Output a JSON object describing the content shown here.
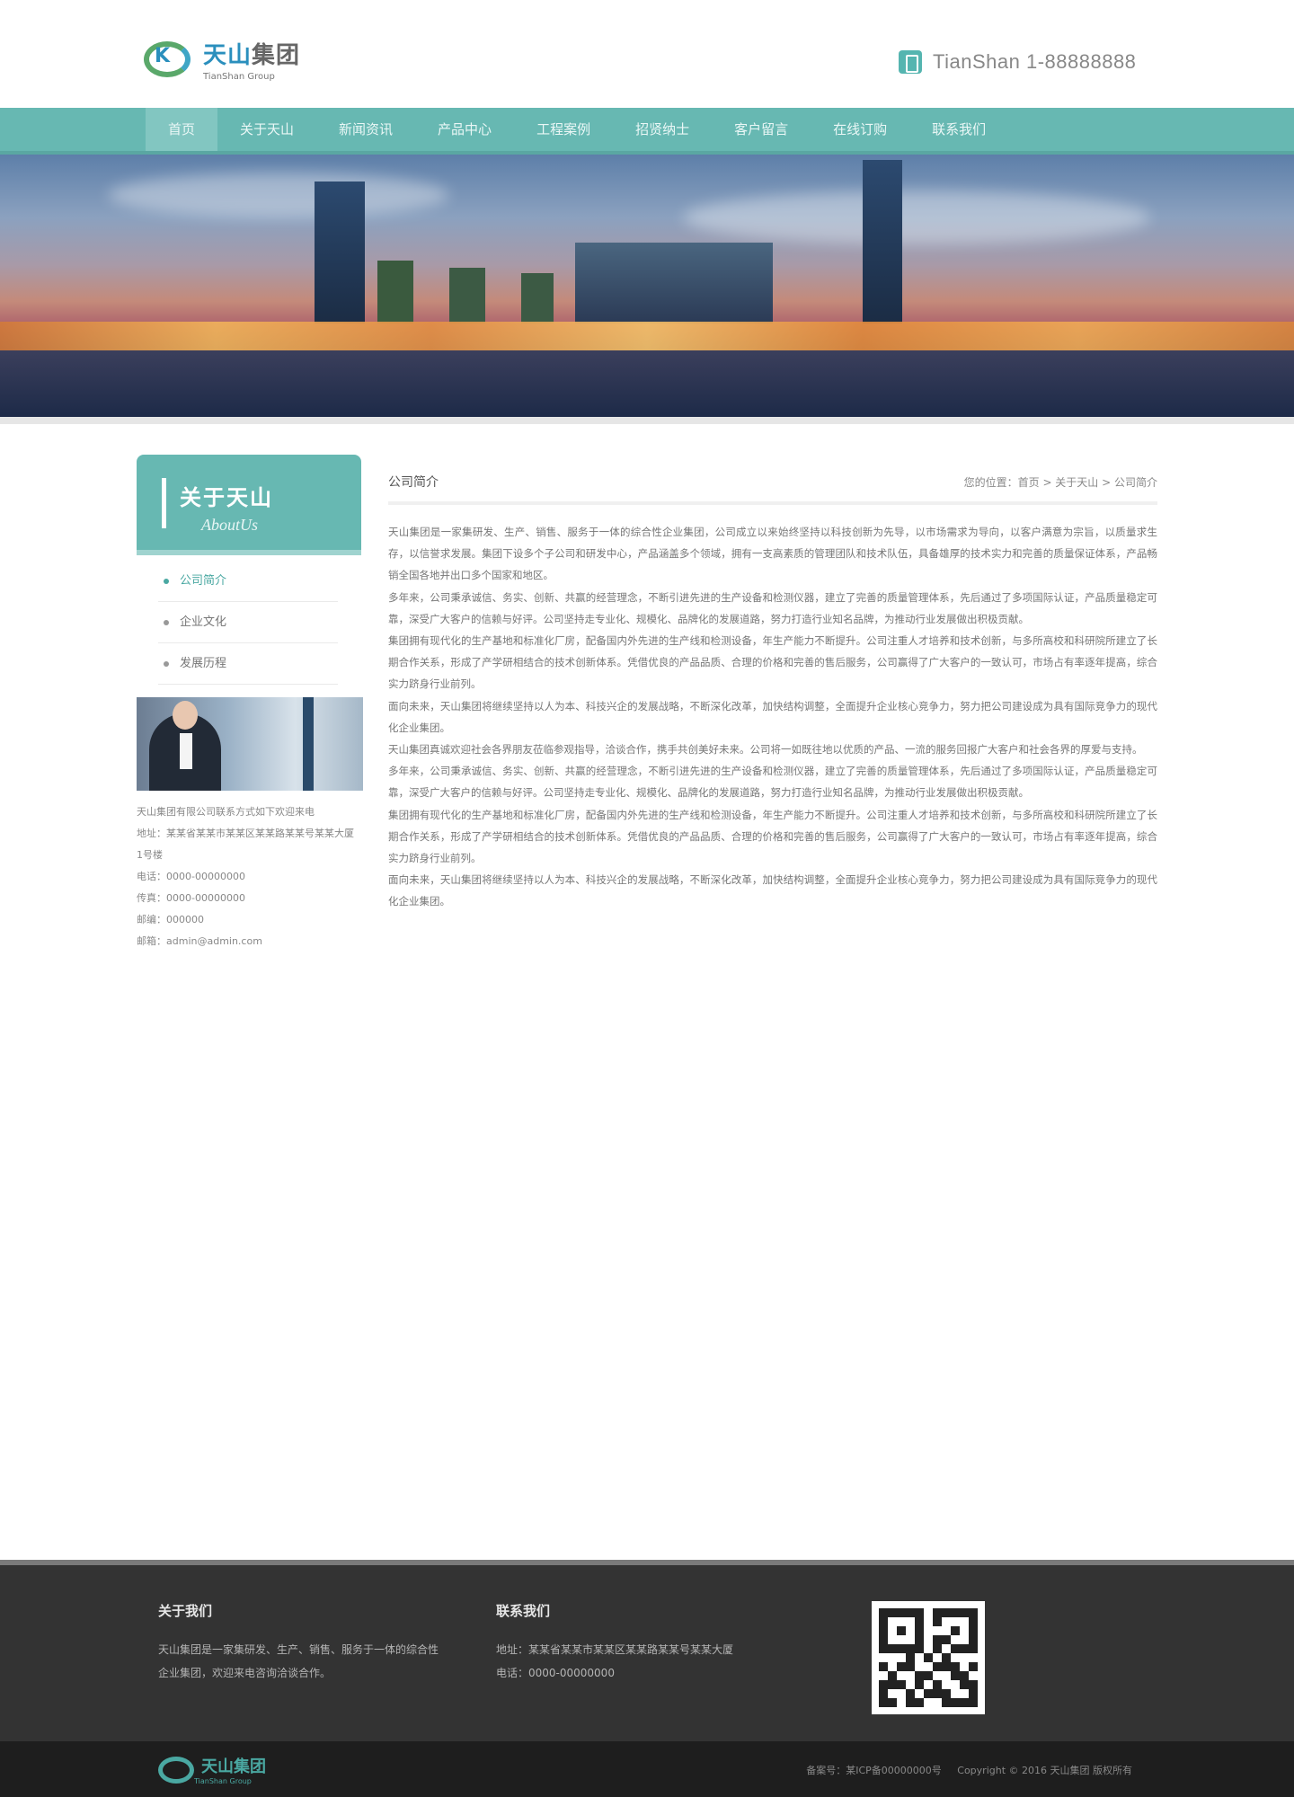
{
  "header": {
    "logo": {
      "cn_blue": "天山",
      "cn_gray": "集团",
      "en": "TianShan Group"
    },
    "hotline": "TianShan 1-88888888"
  },
  "nav": {
    "items": [
      "首页",
      "关于天山",
      "新闻资讯",
      "产品中心",
      "工程案例",
      "招贤纳士",
      "客户留言",
      "在线订购",
      "联系我们"
    ],
    "active_index": 0
  },
  "sidebar": {
    "title_cn": "关于天山",
    "title_en": "AboutUs",
    "menu": [
      "公司简介",
      "企业文化",
      "发展历程"
    ],
    "active_index": 0,
    "contact": {
      "company": "天山集团有限公司联系方式如下欢迎来电",
      "address": "地址：某某省某某市某某区某某路某某号某某大厦",
      "address_line2": "1号楼",
      "phone": "电话：0000-00000000",
      "fax": "传真：0000-00000000",
      "zip": "邮编：000000",
      "email": "邮箱：admin@admin.com"
    }
  },
  "content": {
    "title": "公司简介",
    "breadcrumb": "您的位置：首页 > 关于天山 > 公司简介",
    "paragraphs": [
      "天山集团是一家集研发、生产、销售、服务于一体的综合性企业集团，公司成立以来始终坚持以科技创新为先导，以市场需求为导向，以客户满意为宗旨，以质量求生存，以信誉求发展。集团下设多个子公司和研发中心，产品涵盖多个领域，拥有一支高素质的管理团队和技术队伍，具备雄厚的技术实力和完善的质量保证体系，产品畅销全国各地并出口多个国家和地区。",
      "多年来，公司秉承诚信、务实、创新、共赢的经营理念，不断引进先进的生产设备和检测仪器，建立了完善的质量管理体系，先后通过了多项国际认证，产品质量稳定可靠，深受广大客户的信赖与好评。公司坚持走专业化、规模化、品牌化的发展道路，努力打造行业知名品牌，为推动行业发展做出积极贡献。",
      "集团拥有现代化的生产基地和标准化厂房，配备国内外先进的生产线和检测设备，年生产能力不断提升。公司注重人才培养和技术创新，与多所高校和科研院所建立了长期合作关系，形成了产学研相结合的技术创新体系。凭借优良的产品品质、合理的价格和完善的售后服务，公司赢得了广大客户的一致认可，市场占有率逐年提高，综合实力跻身行业前列。",
      "面向未来，天山集团将继续坚持以人为本、科技兴企的发展战略，不断深化改革，加快结构调整，全面提升企业核心竞争力，努力把公司建设成为具有国际竞争力的现代化企业集团。",
      "天山集团真诚欢迎社会各界朋友莅临参观指导，洽谈合作，携手共创美好未来。公司将一如既往地以优质的产品、一流的服务回报广大客户和社会各界的厚爱与支持。",
      "多年来，公司秉承诚信、务实、创新、共赢的经营理念，不断引进先进的生产设备和检测仪器，建立了完善的质量管理体系，先后通过了多项国际认证，产品质量稳定可靠，深受广大客户的信赖与好评。公司坚持走专业化、规模化、品牌化的发展道路，努力打造行业知名品牌，为推动行业发展做出积极贡献。",
      "集团拥有现代化的生产基地和标准化厂房，配备国内外先进的生产线和检测设备，年生产能力不断提升。公司注重人才培养和技术创新，与多所高校和科研院所建立了长期合作关系，形成了产学研相结合的技术创新体系。凭借优良的产品品质、合理的价格和完善的售后服务，公司赢得了广大客户的一致认可，市场占有率逐年提高，综合实力跻身行业前列。",
      "面向未来，天山集团将继续坚持以人为本、科技兴企的发展战略，不断深化改革，加快结构调整，全面提升企业核心竞争力，努力把公司建设成为具有国际竞争力的现代化企业集团。"
    ]
  },
  "footer": {
    "about_title": "关于我们",
    "about_text": "天山集团是一家集研发、生产、销售、服务于一体的综合性",
    "about_text2": "企业集团，欢迎来电咨询洽谈合作。",
    "contact_title": "联系我们",
    "contact_addr": "地址：某某省某某市某某区某某路某某号某某大厦",
    "contact_phone": "电话：0000-00000000",
    "copyright_left": "备案号：某ICP备00000000号",
    "copyright_right": "Copyright © 2016 天山集团 版权所有",
    "bottom_logo_cn": "天山集团",
    "bottom_logo_en": "TianShan Group"
  },
  "colors": {
    "accent": "#67b8b2",
    "footer_bg": "#333333",
    "bottom_bg": "#1e1e1e"
  },
  "icons": {
    "hotline": "phone-icon",
    "logo": "logo-mark-icon",
    "qr": "qr-code-icon"
  }
}
